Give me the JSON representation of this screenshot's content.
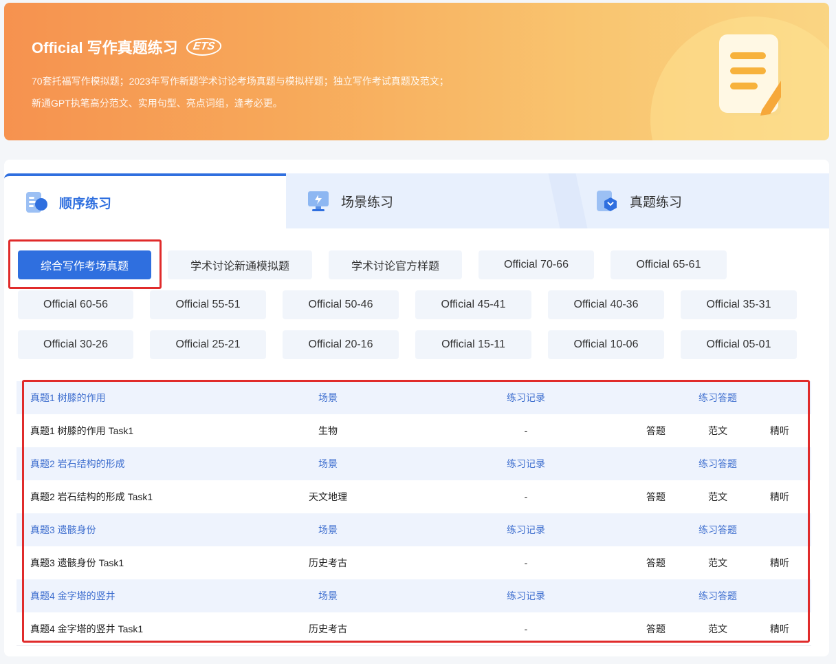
{
  "banner": {
    "title": "Official 写作真题练习",
    "badge": "ETS",
    "desc_line1": "70套托福写作模拟题；2023年写作新题学术讨论考场真题与模拟样题；独立写作考试真题及范文；",
    "desc_line2": "新通GPT执笔高分范文、实用句型、亮点词组，逢考必更。",
    "icon": "notepad-pencil-icon"
  },
  "tabs": [
    {
      "label": "顺序练习",
      "icon": "list-doc-icon",
      "active": true
    },
    {
      "label": "场景练习",
      "icon": "monitor-icon",
      "active": false
    },
    {
      "label": "真题练习",
      "icon": "cube-doc-icon",
      "active": false
    }
  ],
  "filters": [
    {
      "label": "综合写作考场真题",
      "active": true
    },
    {
      "label": "学术讨论新通模拟题"
    },
    {
      "label": "学术讨论官方样题"
    },
    {
      "label": "Official 70-66"
    },
    {
      "label": "Official 65-61"
    },
    {
      "label": "Official 60-56"
    },
    {
      "label": "Official 55-51"
    },
    {
      "label": "Official 50-46"
    },
    {
      "label": "Official 45-41"
    },
    {
      "label": "Official 40-36"
    },
    {
      "label": "Official 35-31"
    },
    {
      "label": "Official 30-26"
    },
    {
      "label": "Official 25-21"
    },
    {
      "label": "Official 20-16"
    },
    {
      "label": "Official 15-11"
    },
    {
      "label": "Official 10-06"
    },
    {
      "label": "Official 05-01"
    }
  ],
  "table": {
    "head_scene": "场景",
    "head_record": "练习记录",
    "head_action": "练习答题",
    "action_answer": "答题",
    "action_sample": "范文",
    "action_listen": "精听",
    "groups": [
      {
        "title": "真题1 树膝的作用",
        "task": "真题1 树膝的作用 Task1",
        "scene": "生物",
        "record": "-"
      },
      {
        "title": "真题2 岩石结构的形成",
        "task": "真题2 岩石结构的形成 Task1",
        "scene": "天文地理",
        "record": "-"
      },
      {
        "title": "真题3 遗骸身份",
        "task": "真题3 遗骸身份 Task1",
        "scene": "历史考古",
        "record": "-"
      },
      {
        "title": "真题4 金字塔的竖井",
        "task": "真题4 金字塔的竖井 Task1",
        "scene": "历史考古",
        "record": "-"
      }
    ]
  },
  "colors": {
    "accent": "#2f6fdf",
    "highlight": "#e02b2b",
    "banner_start": "#f6924f",
    "banner_end": "#fad583"
  }
}
